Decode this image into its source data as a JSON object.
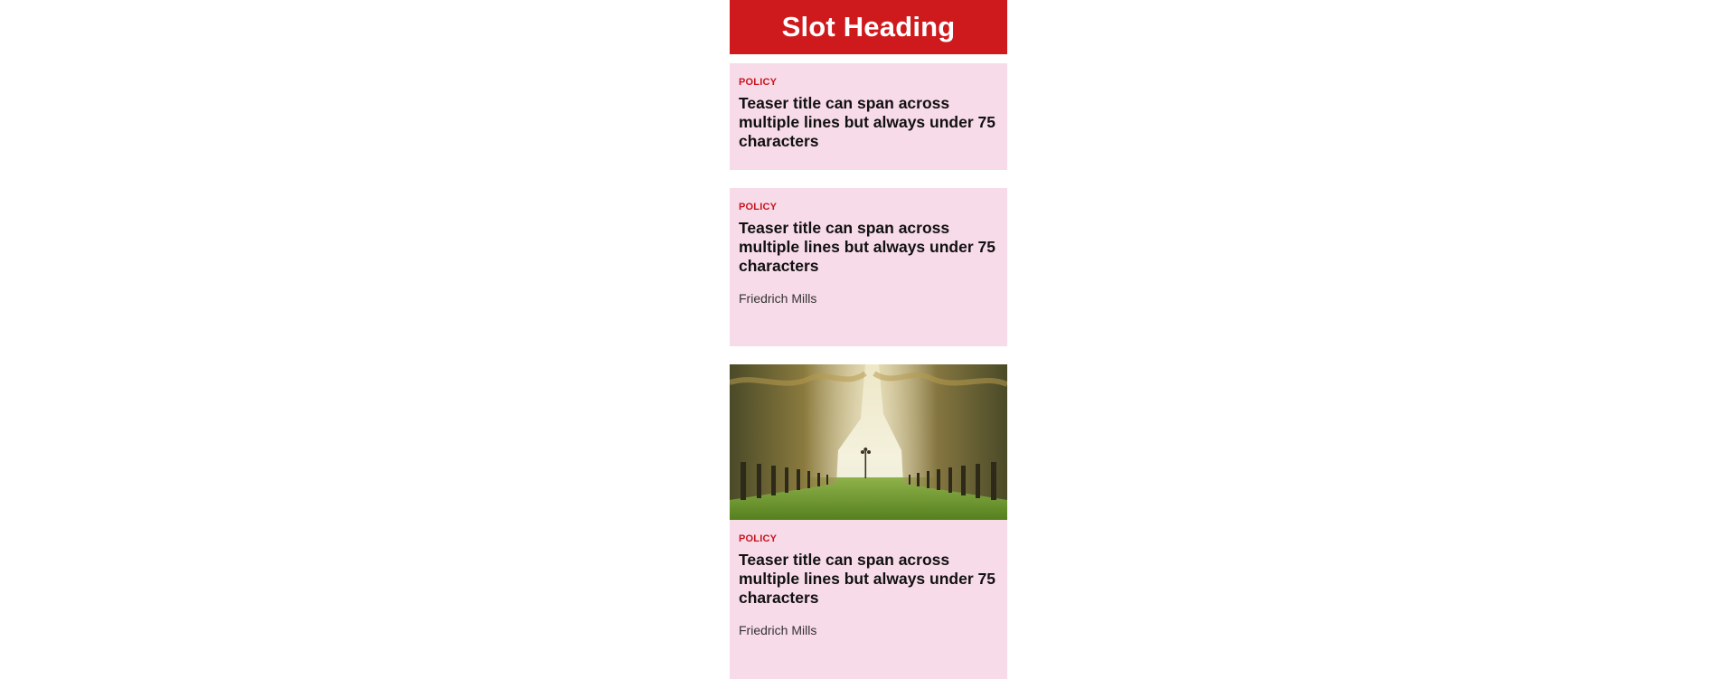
{
  "slot": {
    "heading": "Slot Heading"
  },
  "teasers": [
    {
      "tag": "POLICY",
      "title": "Teaser title can span across multiple lines but always under 75 characters"
    },
    {
      "tag": "POLICY",
      "title": "Teaser title can span across multiple lines but always under 75 characters",
      "author": "Friedrich Mills"
    },
    {
      "image": "palm-tree-avenue-photo",
      "tag": "POLICY",
      "title": "Teaser title can span across multiple lines but always under 75 characters",
      "author": "Friedrich Mills"
    }
  ],
  "colors": {
    "heading_bg": "#cf1a1d",
    "teaser_bg": "#f8dbe9",
    "tag": "#c8151e",
    "title": "#111111"
  }
}
